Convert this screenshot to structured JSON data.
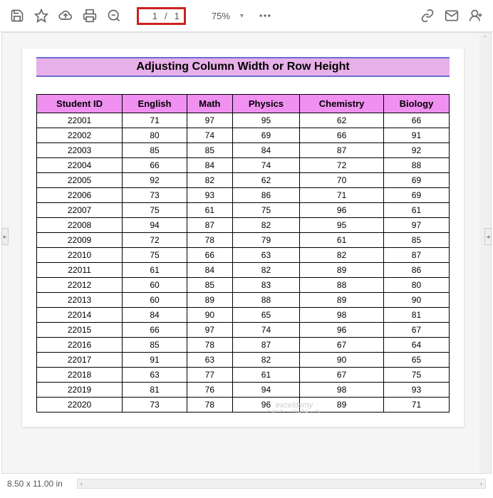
{
  "toolbar": {
    "page_current": "1",
    "page_sep": "/",
    "page_total": "1",
    "zoom": "75%"
  },
  "title": "Adjusting Column Width or Row Height",
  "columns": [
    "Student ID",
    "English",
    "Math",
    "Physics",
    "Chemistry",
    "Biology"
  ],
  "rows": [
    [
      "22001",
      "71",
      "97",
      "95",
      "62",
      "66"
    ],
    [
      "22002",
      "80",
      "74",
      "69",
      "66",
      "91"
    ],
    [
      "22003",
      "85",
      "85",
      "84",
      "87",
      "92"
    ],
    [
      "22004",
      "66",
      "84",
      "74",
      "72",
      "88"
    ],
    [
      "22005",
      "92",
      "82",
      "62",
      "70",
      "69"
    ],
    [
      "22006",
      "73",
      "93",
      "86",
      "71",
      "69"
    ],
    [
      "22007",
      "75",
      "61",
      "75",
      "96",
      "61"
    ],
    [
      "22008",
      "94",
      "87",
      "82",
      "95",
      "97"
    ],
    [
      "22009",
      "72",
      "78",
      "79",
      "61",
      "85"
    ],
    [
      "22010",
      "75",
      "66",
      "63",
      "82",
      "87"
    ],
    [
      "22011",
      "61",
      "84",
      "82",
      "89",
      "86"
    ],
    [
      "22012",
      "60",
      "85",
      "83",
      "88",
      "80"
    ],
    [
      "22013",
      "60",
      "89",
      "88",
      "89",
      "90"
    ],
    [
      "22014",
      "84",
      "90",
      "65",
      "98",
      "81"
    ],
    [
      "22015",
      "66",
      "97",
      "74",
      "96",
      "67"
    ],
    [
      "22016",
      "85",
      "78",
      "87",
      "67",
      "64"
    ],
    [
      "22017",
      "91",
      "63",
      "82",
      "90",
      "65"
    ],
    [
      "22018",
      "63",
      "77",
      "61",
      "67",
      "75"
    ],
    [
      "22019",
      "81",
      "76",
      "94",
      "98",
      "93"
    ],
    [
      "22020",
      "73",
      "78",
      "96",
      "89",
      "71"
    ]
  ],
  "footer": {
    "page_size": "8.50 x 11.00 in"
  },
  "watermark": {
    "l1": "exceldemy",
    "l2": "EXCEL · DATA · BI"
  }
}
